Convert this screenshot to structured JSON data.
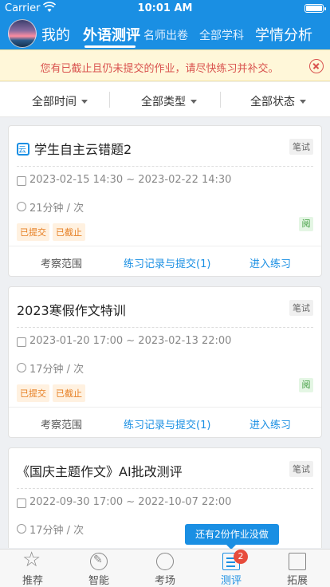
{
  "status": {
    "carrier": "Carrier",
    "time": "10:01 AM"
  },
  "nav": {
    "me": "我的",
    "foreign": "外语测评",
    "teacher": "名师出卷",
    "all_subjects": "全部学科",
    "analysis": "学情分析"
  },
  "notice": {
    "text": "您有已截止且仍未提交的作业，请尽快练习并补交。"
  },
  "filters": {
    "time": "全部时间",
    "type": "全部类型",
    "status": "全部状态"
  },
  "cards": [
    {
      "title": "学生自主云错题2",
      "type": "笔试",
      "date_range": "2023-02-15 14:30 ~ 2023-02-22 14:30",
      "duration": "21分钟 / 次",
      "tags": [
        "已提交",
        "已截止"
      ],
      "read": "阅",
      "scope": "考察范围",
      "records": "练习记录与提交(1)",
      "enter": "进入练习"
    },
    {
      "title": "2023寒假作文特训",
      "type": "笔试",
      "date_range": "2023-01-20 17:00 ~ 2023-02-13 22:00",
      "duration": "17分钟 / 次",
      "tags": [
        "已提交",
        "已截止"
      ],
      "read": "阅",
      "scope": "考察范围",
      "records": "练习记录与提交(1)",
      "enter": "进入练习"
    },
    {
      "title": "《国庆主题作文》AI批改测评",
      "type": "笔试",
      "date_range": "2022-09-30 17:00 ~ 2022-10-07 22:00",
      "duration": "17分钟 / 次",
      "tags": [],
      "read": "",
      "scope": "",
      "records": "",
      "enter": ""
    }
  ],
  "tip": "还有2份作业没做",
  "tabs": [
    {
      "label": "推荐",
      "icon": "star-icon"
    },
    {
      "label": "智能",
      "icon": "pen-icon"
    },
    {
      "label": "考场",
      "icon": "stopwatch-icon"
    },
    {
      "label": "测评",
      "icon": "document-icon",
      "badge": "2"
    },
    {
      "label": "拓展",
      "icon": "person-icon"
    }
  ],
  "colors": {
    "primary": "#1a8fe3",
    "warning": "#d9534f",
    "tag": "#e67e22"
  }
}
